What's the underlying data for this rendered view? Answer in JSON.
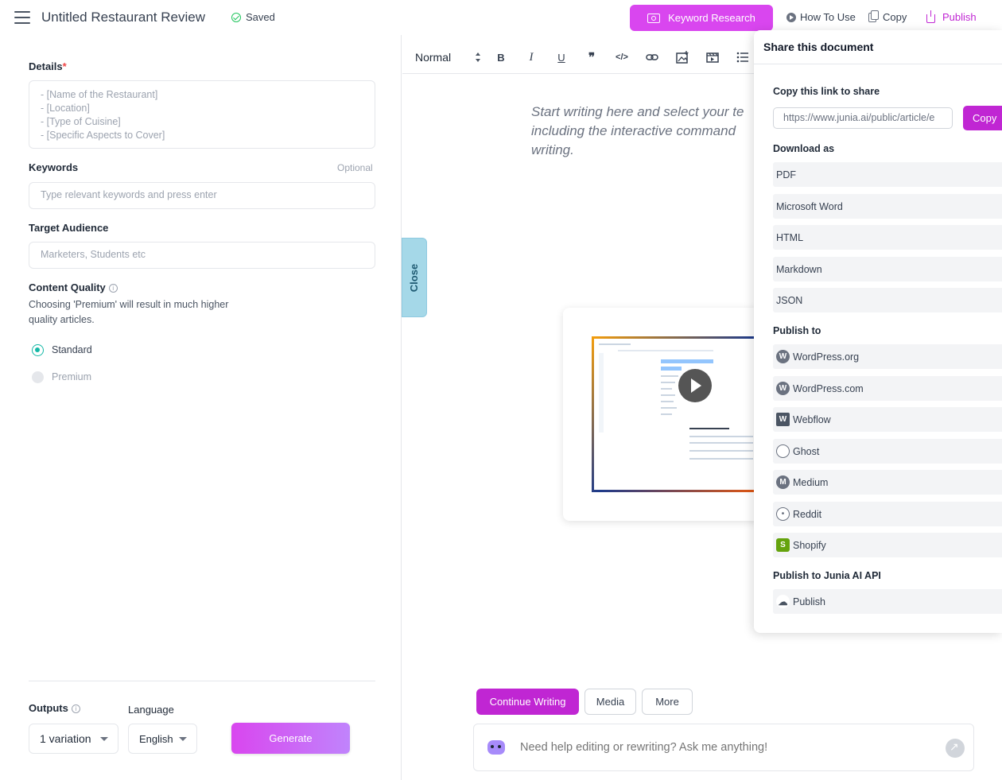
{
  "header": {
    "title": "Untitled Restaurant Review",
    "saved_label": "Saved",
    "keyword_research_label": "Keyword Research",
    "how_to_use_label": "How To Use",
    "copy_label": "Copy",
    "publish_label": "Publish"
  },
  "left_panel": {
    "details_label": "Details",
    "details_required_mark": "*",
    "details_placeholder": "- [Name of the Restaurant]\n- [Location]\n- [Type of Cuisine]\n- [Specific Aspects to Cover]",
    "keywords_label": "Keywords",
    "keywords_optional": "Optional",
    "keywords_placeholder": "Type relevant keywords and press enter",
    "audience_label": "Target Audience",
    "audience_placeholder": "Marketers, Students etc",
    "quality_label": "Content Quality",
    "quality_help": "Choosing 'Premium' will result in much higher quality articles.",
    "quality_options": [
      {
        "label": "Standard",
        "selected": true
      },
      {
        "label": "Premium",
        "selected": false
      }
    ],
    "outputs_label": "Outputs",
    "outputs_value": "1 variation",
    "language_label": "Language",
    "language_value": "English",
    "generate_label": "Generate"
  },
  "close_tab_label": "Close",
  "toolbar": {
    "style_value": "Normal"
  },
  "editor": {
    "placeholder": "Start writing here and select your te\nincluding the interactive command\nwriting."
  },
  "bottom": {
    "continue_writing_label": "Continue Writing",
    "media_label": "Media",
    "more_label": "More",
    "ask_placeholder": "Need help editing or rewriting? Ask me anything!"
  },
  "share_panel": {
    "title": "Share this document",
    "copy_link_label": "Copy this link to share",
    "link_value": "https://www.junia.ai/public/article/e",
    "copy_button_label": "Copy",
    "download_label": "Download as",
    "download_options": [
      "PDF",
      "Microsoft Word",
      "HTML",
      "Markdown",
      "JSON"
    ],
    "publish_to_label": "Publish to",
    "publish_targets": [
      {
        "label": "WordPress.org",
        "icon": "wordpress-icon"
      },
      {
        "label": "WordPress.com",
        "icon": "wordpress-icon"
      },
      {
        "label": "Webflow",
        "icon": "webflow-icon"
      },
      {
        "label": "Ghost",
        "icon": "ghost-icon"
      },
      {
        "label": "Medium",
        "icon": "medium-icon"
      },
      {
        "label": "Reddit",
        "icon": "reddit-icon"
      },
      {
        "label": "Shopify",
        "icon": "shopify-icon"
      }
    ],
    "api_label": "Publish to Junia AI API",
    "api_publish_label": "Publish"
  },
  "colors": {
    "accent": "#c026d3",
    "keyword_button": "#d946ef",
    "radio_selected": "#14b8a6",
    "close_tab": "#a5d8e8"
  }
}
